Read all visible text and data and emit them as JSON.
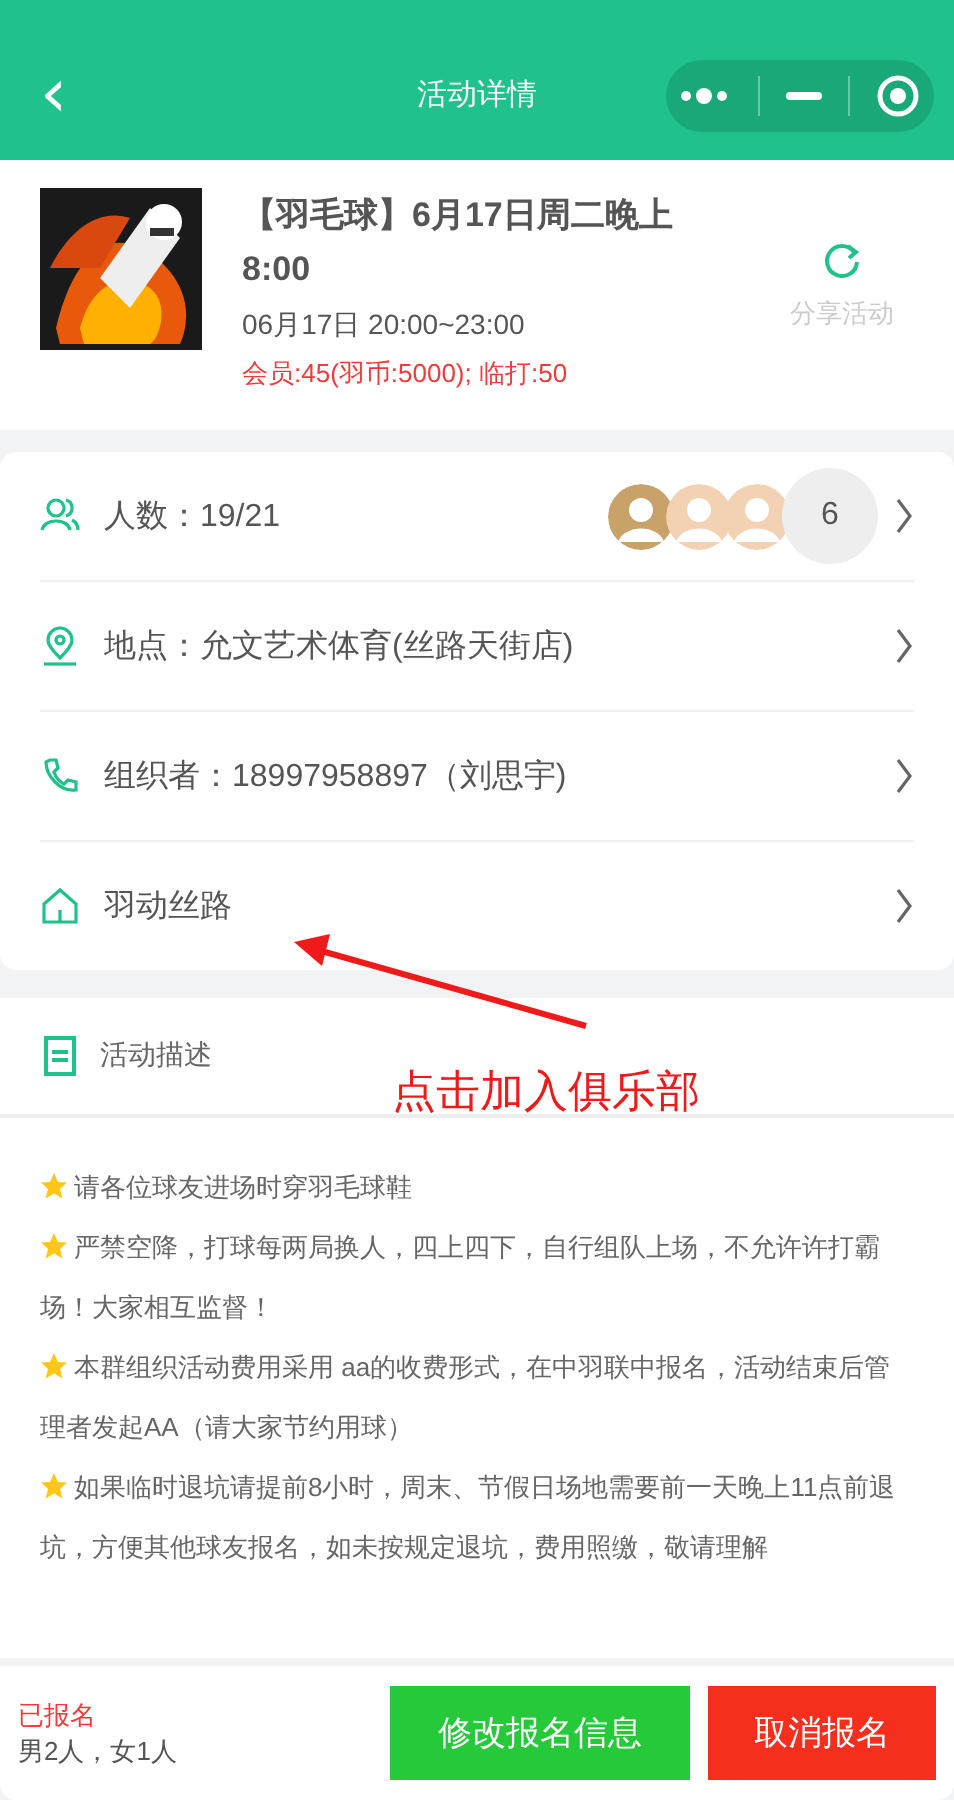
{
  "header": {
    "back": "‹",
    "title": "活动详情"
  },
  "event": {
    "title": "【羽毛球】6月17日周二晚上8:00",
    "time": "06月17日 20:00~23:00",
    "price": "会员:45(羽币:5000); 临打:50",
    "share": "分享活动"
  },
  "info": [
    {
      "kind": "people",
      "label": "人数：19/21",
      "more": "6"
    },
    {
      "kind": "place",
      "label": "地点：允文艺术体育(丝路天街店)"
    },
    {
      "kind": "phone",
      "label": "组织者：18997958897（刘思宇)"
    },
    {
      "kind": "club",
      "label": "羽动丝路"
    }
  ],
  "annotation": "点击加入俱乐部",
  "description": {
    "title": "活动描述",
    "items": [
      "请各位球友进场时穿羽毛球鞋",
      "严禁空降，打球每两局换人，四上四下，自行组队上场，不允许许打霸场！大家相互监督！",
      "本群组织活动费用采用 aa的收费形式，在中羽联中报名，活动结束后管理者发起AA（请大家节约用球）",
      "如果临时退坑请提前8小时，周末、节假日场地需要前一天晚上11点前退坑，方便其他球友报名，如未按规定退坑，费用照缴，敬请理解"
    ]
  },
  "footer": {
    "status": "已报名",
    "counts": "男2人，女1人",
    "buttons": [
      {
        "kind": "edit",
        "label": "修改报名信息"
      },
      {
        "kind": "cancel",
        "label": "取消报名"
      }
    ]
  }
}
